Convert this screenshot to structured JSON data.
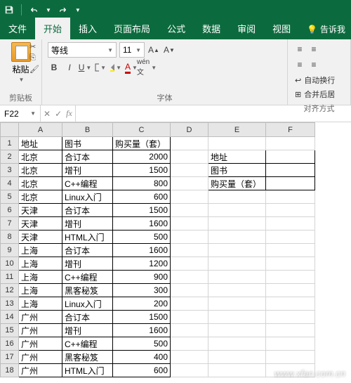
{
  "qat": {
    "save": "save-icon",
    "undo": "undo-icon",
    "redo": "redo-icon"
  },
  "tabs": {
    "file": "文件",
    "home": "开始",
    "insert": "插入",
    "layout": "页面布局",
    "formula": "公式",
    "data": "数据",
    "review": "审阅",
    "view": "视图",
    "tell_me": "告诉我"
  },
  "ribbon": {
    "paste": "粘贴",
    "clipboard_label": "剪贴板",
    "font_name": "等线",
    "font_size": "11",
    "font_label": "字体",
    "autowrap": "自动换行",
    "merge": "合并后居",
    "align_label": "对齐方式"
  },
  "namebox": "F22",
  "fx": "fx",
  "columns": [
    "A",
    "B",
    "C",
    "D",
    "E",
    "F"
  ],
  "headers": {
    "c1": "地址",
    "c2": "图书",
    "c3": "购买量（套）"
  },
  "data": [
    {
      "a": "北京",
      "b": "合订本",
      "c": "2000"
    },
    {
      "a": "北京",
      "b": "增刊",
      "c": "1500"
    },
    {
      "a": "北京",
      "b": "C++编程",
      "c": "800"
    },
    {
      "a": "北京",
      "b": "Linux入门",
      "c": "600"
    },
    {
      "a": "天津",
      "b": "合订本",
      "c": "1500"
    },
    {
      "a": "天津",
      "b": "增刊",
      "c": "1600"
    },
    {
      "a": "天津",
      "b": "HTML入门",
      "c": "500"
    },
    {
      "a": "上海",
      "b": "合订本",
      "c": "1600"
    },
    {
      "a": "上海",
      "b": "增刊",
      "c": "1200"
    },
    {
      "a": "上海",
      "b": "C++编程",
      "c": "900"
    },
    {
      "a": "上海",
      "b": "黑客秘笈",
      "c": "300"
    },
    {
      "a": "上海",
      "b": "Linux入门",
      "c": "200"
    },
    {
      "a": "广州",
      "b": "合订本",
      "c": "1500"
    },
    {
      "a": "广州",
      "b": "增刊",
      "c": "1600"
    },
    {
      "a": "广州",
      "b": "C++编程",
      "c": "500"
    },
    {
      "a": "广州",
      "b": "黑客秘笈",
      "c": "400"
    },
    {
      "a": "广州",
      "b": "HTML入门",
      "c": "600"
    }
  ],
  "side": {
    "r2": "地址",
    "r3": "图书",
    "r4": "购买量（套）"
  },
  "watermark": "www.xfan.com.cn"
}
